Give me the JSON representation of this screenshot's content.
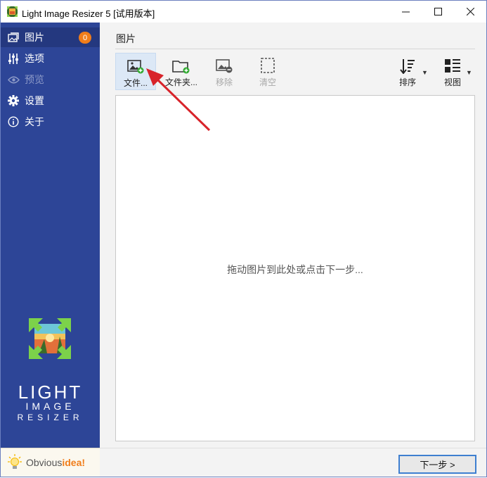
{
  "window": {
    "title": "Light Image Resizer 5  [试用版本]",
    "controls": {
      "minimize": "—",
      "maximize": "☐",
      "close": "✕"
    }
  },
  "sidebar": {
    "items": [
      {
        "label": "图片",
        "icon": "images-icon",
        "badge": "0",
        "active": true
      },
      {
        "label": "选项",
        "icon": "sliders-icon"
      },
      {
        "label": "预览",
        "icon": "eye-icon",
        "disabled": true
      },
      {
        "label": "设置",
        "icon": "gear-icon"
      },
      {
        "label": "关于",
        "icon": "info-icon"
      }
    ],
    "logo": {
      "line1": "LIGHT",
      "line2": "IMAGE",
      "line3": "RESIZER"
    },
    "brand": {
      "prefix": "Obvious",
      "suffix": "idea!"
    }
  },
  "main": {
    "section_title": "图片",
    "toolbar": {
      "file": "文件...",
      "folder": "文件夹...",
      "remove": "移除",
      "clear": "清空",
      "sort": "排序",
      "view": "视图"
    },
    "drop_hint": "拖动图片到此处或点击下一步...",
    "next_button": "下一步 >"
  },
  "colors": {
    "sidebar": "#2d4597",
    "sidebar_active": "#24387f",
    "badge": "#f07d1a",
    "accent": "#3e7fd0",
    "annotation_arrow": "#d8232a"
  }
}
